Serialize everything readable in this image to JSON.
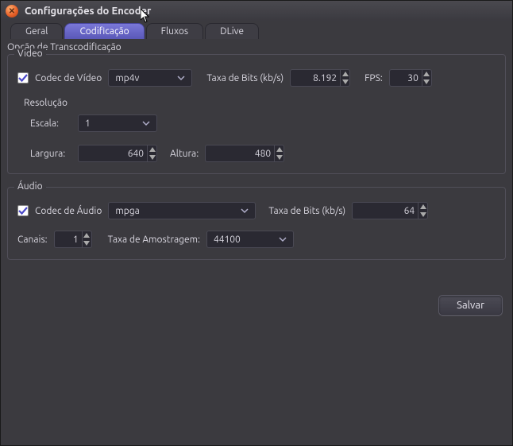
{
  "window": {
    "title": "Configurações do Encoder"
  },
  "tabs": {
    "geral": "Geral",
    "codificacao": "Codificação",
    "fluxos": "Fluxos",
    "dlive": "DLive"
  },
  "transcoding": {
    "label": "Opção de Transcodificação"
  },
  "video": {
    "group": "Video",
    "codec_label": "Codec de Vídeo",
    "codec_value": "mp4v",
    "bitrate_label": "Taxa de Bits (kb/s)",
    "bitrate_value": "8.192",
    "fps_label": "FPS:",
    "fps_value": "30",
    "resolution_label": "Resolução",
    "scale_label": "Escala:",
    "scale_value": "1",
    "width_label": "Largura:",
    "width_value": "640",
    "height_label": "Altura:",
    "height_value": "480"
  },
  "audio": {
    "group": "Áudio",
    "codec_label": "Codec de Áudio",
    "codec_value": "mpga",
    "bitrate_label": "Taxa de Bits (kb/s)",
    "bitrate_value": "64",
    "channels_label": "Canais:",
    "channels_value": "1",
    "samplerate_label": "Taxa de Amostragem:",
    "samplerate_value": "44100"
  },
  "buttons": {
    "save": "Salvar"
  }
}
